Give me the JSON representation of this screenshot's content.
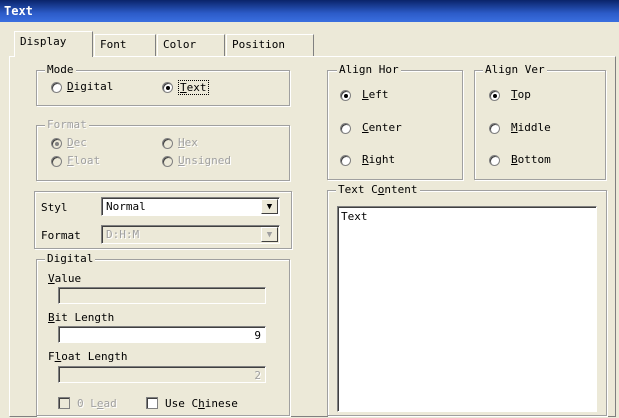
{
  "window": {
    "title": "Text"
  },
  "tabs": [
    {
      "label": "Display"
    },
    {
      "label": "Font"
    },
    {
      "label": "Color"
    },
    {
      "label": "Position"
    }
  ],
  "mode": {
    "legend": "Mode",
    "digital": {
      "label": "Digital",
      "selected": false
    },
    "text": {
      "label": "Text",
      "selected": true
    }
  },
  "format_group": {
    "legend": "Format",
    "dec": "Dec",
    "hex": "Hex",
    "float": "Float",
    "unsigned": "Unsigned"
  },
  "style": {
    "label": "Styl",
    "value": "Normal",
    "format_label": "Format",
    "format_value": "D:H:M"
  },
  "digital": {
    "legend": "Digital",
    "value_label": "Value",
    "value": "",
    "bit_length_label": "Bit Length",
    "bit_length": "9",
    "float_length_label": "Float Length",
    "float_length": "2",
    "zero_lead_label": "0 Lead",
    "use_chinese_label": "Use Chinese"
  },
  "align_hor": {
    "legend": "Align Hor",
    "left": "Left",
    "center": "Center",
    "right": "Right",
    "selected": "Left"
  },
  "align_ver": {
    "legend": "Align Ver",
    "top": "Top",
    "middle": "Middle",
    "bottom": "Bottom",
    "selected": "Top"
  },
  "text_content": {
    "legend": "Text Content",
    "value": "Text"
  }
}
